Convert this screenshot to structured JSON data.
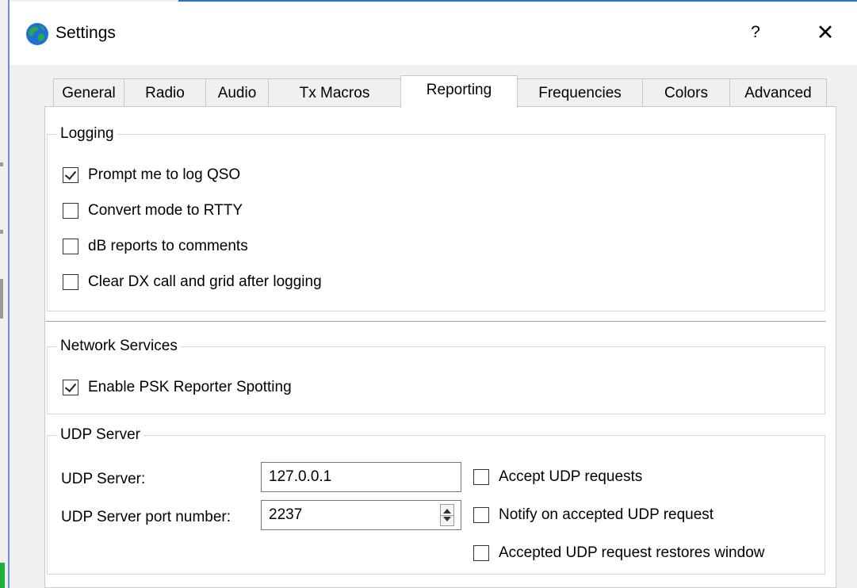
{
  "window": {
    "title": "Settings",
    "help_label": "?",
    "close_label": "✕",
    "icon": "globe-icon"
  },
  "tabs": [
    {
      "label": "General"
    },
    {
      "label": "Radio"
    },
    {
      "label": "Audio"
    },
    {
      "label": "Tx Macros"
    },
    {
      "label": "Reporting",
      "active": true
    },
    {
      "label": "Frequencies"
    },
    {
      "label": "Colors"
    },
    {
      "label": "Advanced"
    }
  ],
  "logging": {
    "title": "Logging",
    "options": [
      {
        "label": "Prompt me to log QSO",
        "checked": true
      },
      {
        "label": "Convert mode to RTTY",
        "checked": false
      },
      {
        "label": "dB reports to comments",
        "checked": false
      },
      {
        "label": "Clear DX call and grid after logging",
        "checked": false
      }
    ]
  },
  "network": {
    "title": "Network Services",
    "options": [
      {
        "label": "Enable PSK Reporter Spotting",
        "checked": true
      }
    ]
  },
  "udp": {
    "title": "UDP Server",
    "server_label": "UDP Server:",
    "server_value": "127.0.0.1",
    "port_label": "UDP Server port number:",
    "port_value": "2237",
    "options": [
      {
        "label": "Accept UDP requests",
        "checked": false
      },
      {
        "label": "Notify on accepted UDP request",
        "checked": false
      },
      {
        "label": "Accepted UDP request restores window",
        "checked": false
      }
    ]
  },
  "colors": {
    "accent": "#2a72c8",
    "window_bg": "#f0f0f0",
    "panel_bg": "#ffffff"
  }
}
